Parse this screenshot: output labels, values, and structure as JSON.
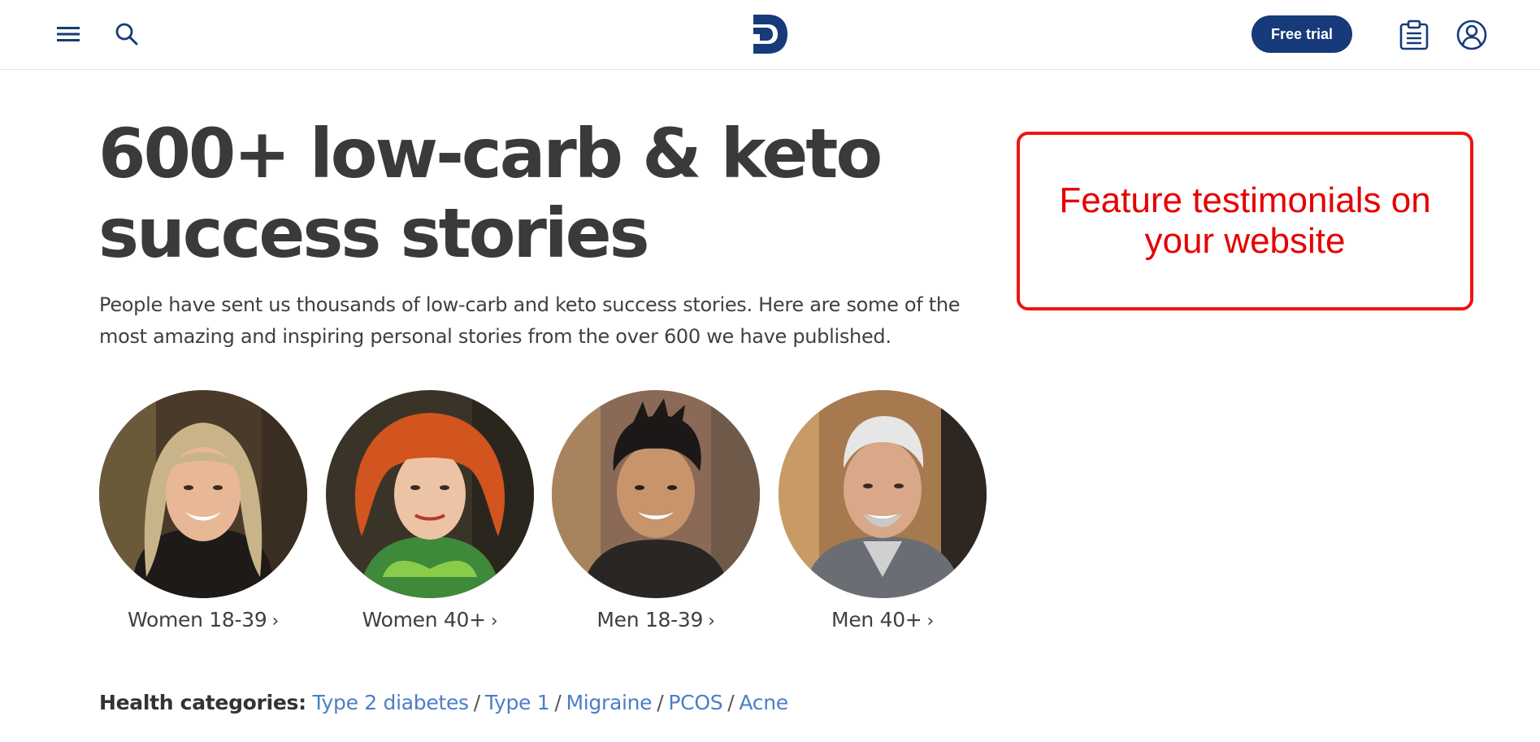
{
  "header": {
    "menu_icon": "hamburger-menu-icon",
    "search_icon": "search-icon",
    "logo_icon": "diet-doctor-d-logo",
    "cta_label": "Free trial",
    "cta_color": "#163a7a",
    "clipboard_icon": "clipboard-icon",
    "account_icon": "user-account-icon"
  },
  "main": {
    "title_line1": "600+ low-carb & keto",
    "title_line2": "success stories",
    "intro": "People have sent us thousands of low-carb and keto success stories. Here are some of the most amazing and inspiring personal stories from the over 600 we have published."
  },
  "callout": {
    "text": "Feature testimonials on your website",
    "color": "#e60000"
  },
  "categories": [
    {
      "label": "Women 18-39"
    },
    {
      "label": "Women 40+"
    },
    {
      "label": "Men 18-39"
    },
    {
      "label": "Men 40+"
    }
  ],
  "health": {
    "heading": "Health categories:",
    "links": [
      "Type 2 diabetes",
      "Type 1",
      "Migraine",
      "PCOS",
      "Acne"
    ],
    "link_color": "#4d7ec6"
  }
}
